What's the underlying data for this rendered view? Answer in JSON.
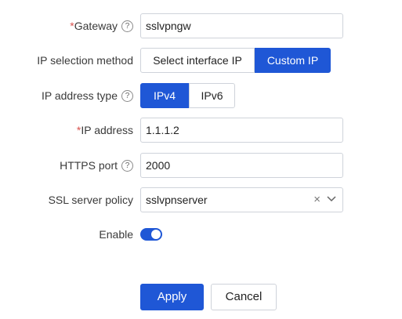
{
  "form": {
    "gateway": {
      "required_mark": "*",
      "label": "Gateway",
      "help": "?",
      "value": "sslvpngw"
    },
    "ip_selection": {
      "label": "IP selection method",
      "options": [
        "Select interface IP",
        "Custom IP"
      ],
      "selected": "Custom IP"
    },
    "ip_type": {
      "label": "IP address type",
      "help": "?",
      "options": [
        "IPv4",
        "IPv6"
      ],
      "selected": "IPv4"
    },
    "ip_address": {
      "required_mark": "*",
      "label": "IP address",
      "value": "1.1.1.2"
    },
    "https_port": {
      "label": "HTTPS port",
      "help": "?",
      "value": "2000"
    },
    "ssl_policy": {
      "label": "SSL server policy",
      "value": "sslvpnserver",
      "clear": "×"
    },
    "enable": {
      "label": "Enable",
      "on": true
    }
  },
  "actions": {
    "apply": "Apply",
    "cancel": "Cancel"
  },
  "colors": {
    "accent": "#1f57d6",
    "required": "#d9534f",
    "border": "#cfd3da"
  }
}
